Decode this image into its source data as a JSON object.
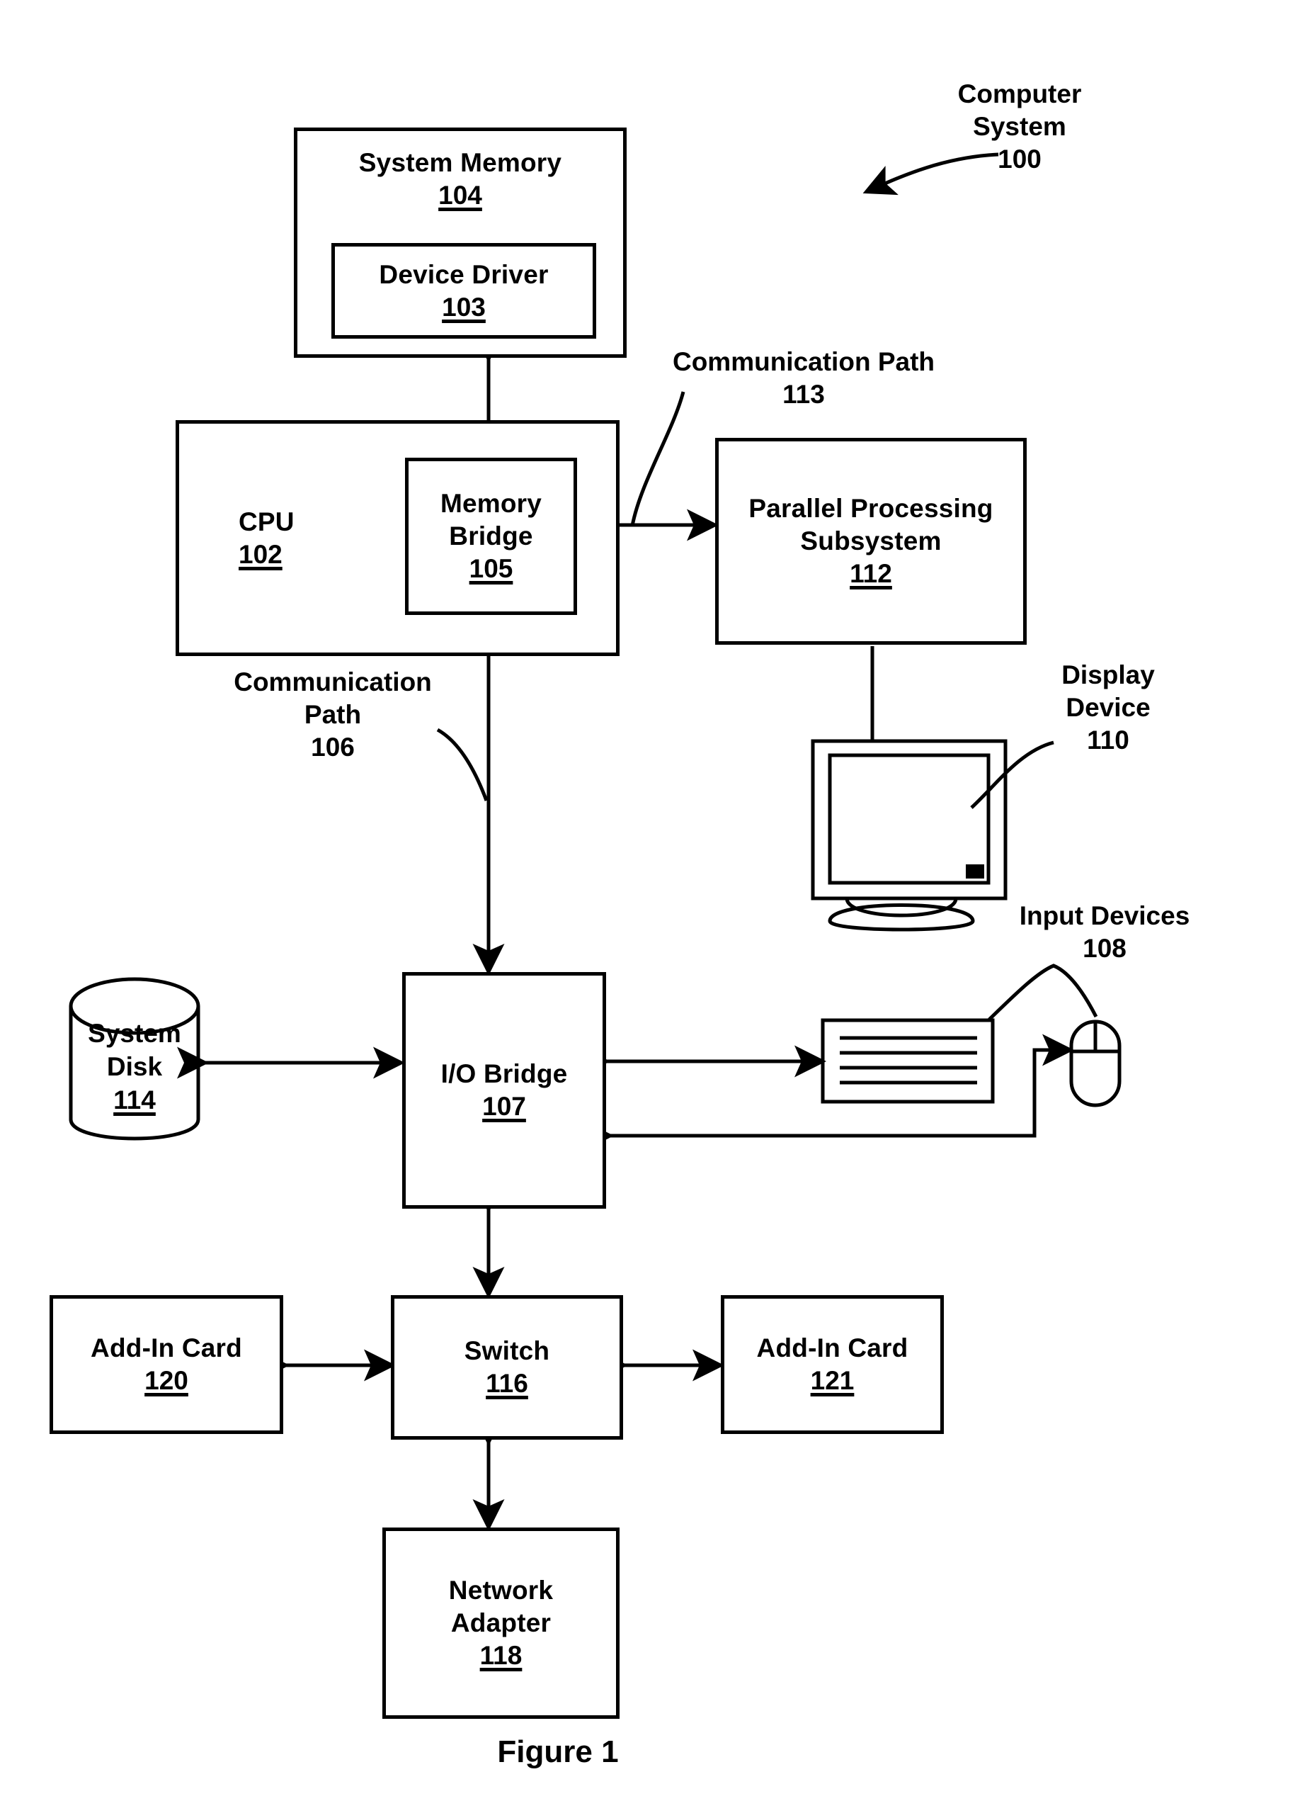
{
  "figure": {
    "caption": "Figure 1",
    "system_label": {
      "line1": "Computer",
      "line2": "System",
      "number": "100"
    }
  },
  "blocks": {
    "system_memory": {
      "title": "System Memory",
      "number": "104"
    },
    "device_driver": {
      "title": "Device Driver",
      "number": "103"
    },
    "cpu": {
      "title": "CPU",
      "number": "102"
    },
    "memory_bridge": {
      "line1": "Memory",
      "line2": "Bridge",
      "number": "105"
    },
    "parallel_processing_subsystem": {
      "line1": "Parallel Processing",
      "line2": "Subsystem",
      "number": "112"
    },
    "io_bridge": {
      "title": "I/O Bridge",
      "number": "107"
    },
    "system_disk": {
      "line1": "System",
      "line2": "Disk",
      "number": "114"
    },
    "switch": {
      "title": "Switch",
      "number": "116"
    },
    "add_in_card_left": {
      "title": "Add-In Card",
      "number": "120"
    },
    "add_in_card_right": {
      "title": "Add-In Card",
      "number": "121"
    },
    "network_adapter": {
      "line1": "Network",
      "line2": "Adapter",
      "number": "118"
    }
  },
  "annotations": {
    "communication_path_113": {
      "line1": "Communication Path",
      "number": "113"
    },
    "communication_path_106": {
      "line1": "Communication",
      "line2": "Path",
      "number": "106"
    },
    "display_device_110": {
      "line1": "Display",
      "line2": "Device",
      "number": "110"
    },
    "input_devices_108": {
      "line1": "Input Devices",
      "number": "108"
    }
  },
  "icons": {
    "display_device": "monitor-icon",
    "system_disk": "cylinder-database-icon",
    "keyboard": "keyboard-icon",
    "mouse": "mouse-icon"
  },
  "colors": {
    "ink": "#000000",
    "paper": "#ffffff"
  }
}
